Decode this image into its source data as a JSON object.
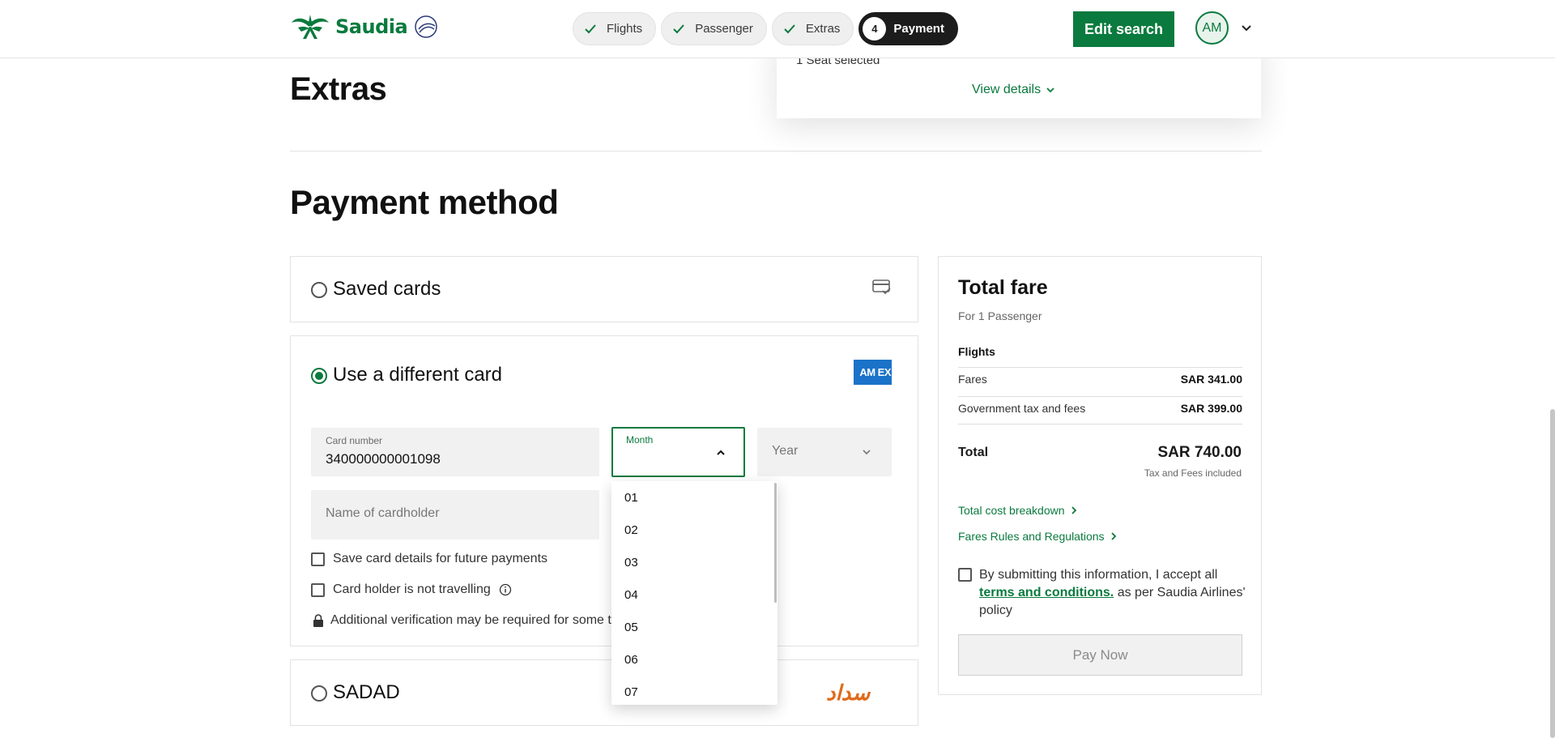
{
  "header": {
    "brand": "Saudia",
    "steps": [
      {
        "label": "Flights"
      },
      {
        "label": "Passenger"
      },
      {
        "label": "Extras"
      },
      {
        "number": "4",
        "label": "Payment"
      }
    ],
    "edit_search": "Edit search",
    "avatar_initials": "AM"
  },
  "summary": {
    "seat_text": "1 Seat selected",
    "view_details": "View details"
  },
  "extras_title": "Extras",
  "payment": {
    "title": "Payment method",
    "saved_cards": "Saved cards",
    "different_card": "Use a different card",
    "amex_text": "AM EX",
    "card_number_label": "Card number",
    "card_number_value": "340000000001098",
    "month_label": "Month",
    "year_placeholder": "Year",
    "cardholder_placeholder": "Name of cardholder",
    "save_card": "Save card details for future payments",
    "not_travelling": "Card holder is not travelling",
    "notice": "Additional verification may be required for some transactions",
    "sadad": "SADAD",
    "sadad_logo": "سداد",
    "months": [
      "01",
      "02",
      "03",
      "04",
      "05",
      "06",
      "07"
    ]
  },
  "fare": {
    "title": "Total fare",
    "subtitle": "For 1 Passenger",
    "section": "Flights",
    "fares_label": "Fares",
    "fares_value": "SAR 341.00",
    "tax_label": "Government tax and fees",
    "tax_value": "SAR 399.00",
    "total_label": "Total",
    "total_value": "SAR 740.00",
    "tax_note": "Tax and Fees included",
    "breakdown_link": "Total cost breakdown",
    "rules_link": "Fares Rules and Regulations",
    "terms_pre": "By submitting this information, I accept all",
    "terms_link": "terms and conditions.",
    "terms_post": "as per Saudia Airlines' policy",
    "pay_now": "Pay Now"
  },
  "colors": {
    "brand_green": "#0a7a3e",
    "amex_blue": "#1a73c8",
    "sadad_orange": "#e06a1a"
  }
}
